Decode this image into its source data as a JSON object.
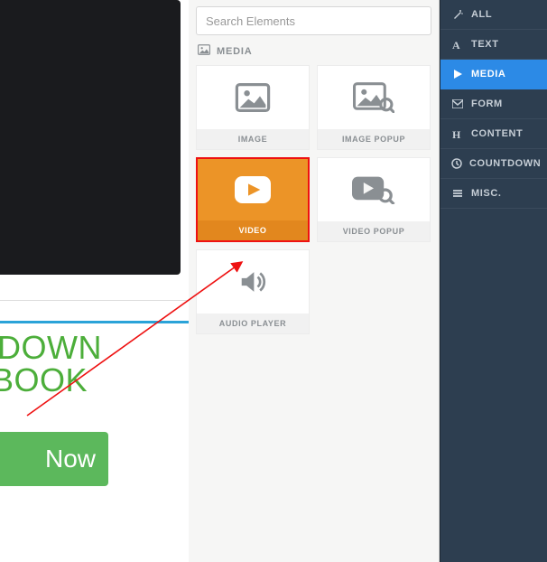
{
  "search": {
    "placeholder": "Search Elements"
  },
  "category_header": {
    "label": "MEDIA"
  },
  "tiles": {
    "image": "IMAGE",
    "image_popup": "IMAGE POPUP",
    "video": "VIDEO",
    "video_popup": "VIDEO POPUP",
    "audio_player": "AUDIO PLAYER"
  },
  "sidebar": {
    "items": [
      {
        "label": "ALL"
      },
      {
        "label": "TEXT"
      },
      {
        "label": "MEDIA"
      },
      {
        "label": "FORM"
      },
      {
        "label": "CONTENT"
      },
      {
        "label": "COUNTDOWN"
      },
      {
        "label": "MISC."
      }
    ]
  },
  "canvas": {
    "headline1": "D DOWN",
    "headline2": "RKBOOK",
    "button": "Now"
  }
}
